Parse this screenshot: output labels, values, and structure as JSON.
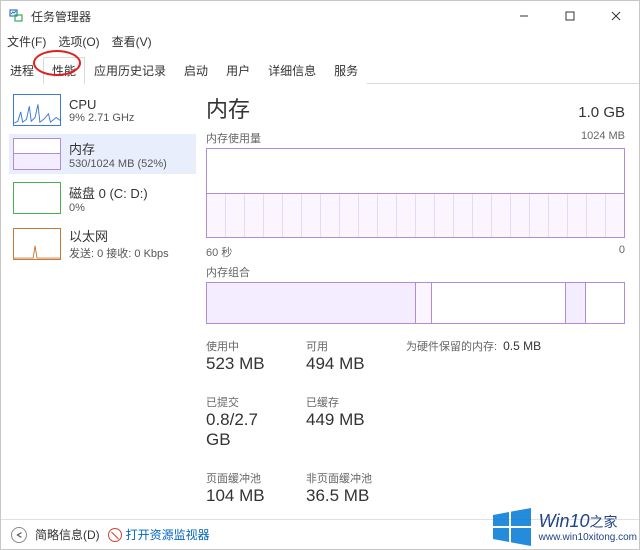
{
  "titlebar": {
    "title": "任务管理器"
  },
  "menu": {
    "file": "文件(F)",
    "options": "选项(O)",
    "view": "查看(V)"
  },
  "tabs": {
    "processes": "进程",
    "performance": "性能",
    "app_history": "应用历史记录",
    "startup": "启动",
    "users": "用户",
    "details": "详细信息",
    "services": "服务"
  },
  "sidebar": {
    "cpu": {
      "title": "CPU",
      "subtitle": "9% 2.71 GHz"
    },
    "memory": {
      "title": "内存",
      "subtitle": "530/1024 MB (52%)"
    },
    "disk": {
      "title": "磁盘 0 (C: D:)",
      "subtitle": "0%"
    },
    "ethernet": {
      "title": "以太网",
      "subtitle": "发送: 0 接收: 0 Kbps"
    }
  },
  "main": {
    "heading": "内存",
    "capacity": "1.0 GB",
    "usage_label": "内存使用量",
    "usage_scale": "1024 MB",
    "time_left": "60 秒",
    "time_right": "0",
    "comp_label": "内存组合",
    "stats": {
      "in_use_label": "使用中",
      "in_use": "523 MB",
      "available_label": "可用",
      "available": "494 MB",
      "hw_reserved_label": "为硬件保留的内存:",
      "hw_reserved": "0.5 MB",
      "committed_label": "已提交",
      "committed": "0.8/2.7 GB",
      "cached_label": "已缓存",
      "cached": "449 MB",
      "paged_label": "页面缓冲池",
      "paged": "104 MB",
      "nonpaged_label": "非页面缓冲池",
      "nonpaged": "36.5 MB"
    }
  },
  "footer": {
    "fewer": "简略信息(D)",
    "open_resmon": "打开资源监视器"
  },
  "watermark": {
    "brand": "Win10",
    "suffix": "之家",
    "url": "www.win10xitong.com"
  },
  "chart_data": {
    "usage_chart": {
      "type": "area",
      "title": "内存使用量",
      "ylim": [
        0,
        1024
      ],
      "y_unit": "MB",
      "x_range_seconds": 60,
      "approx_level_mb": 530
    },
    "composition": {
      "type": "bar",
      "title": "内存组合",
      "total_mb": 1024,
      "approx_segments_mb": {
        "in_use": 523,
        "modified": 40,
        "standby": 330,
        "free": 50,
        "reserved": 81
      }
    }
  }
}
